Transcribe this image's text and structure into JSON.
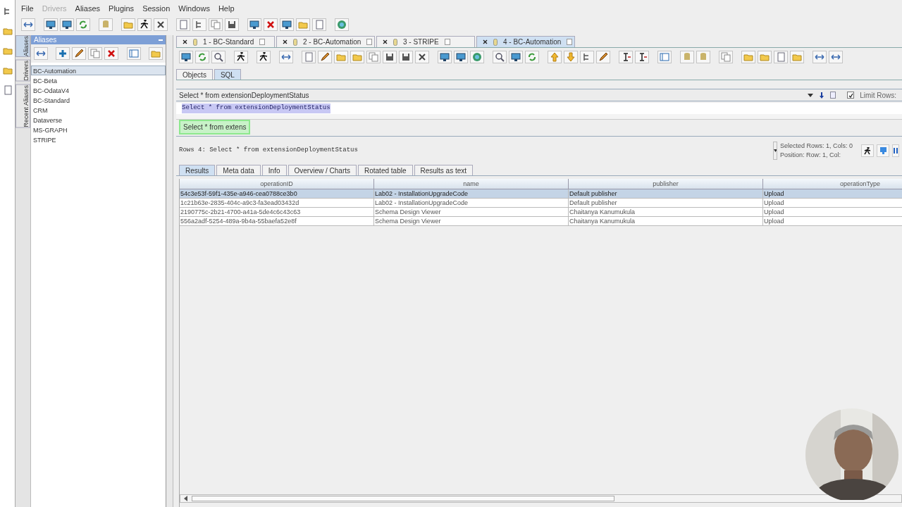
{
  "menu": [
    {
      "label": "File",
      "disabled": false
    },
    {
      "label": "Drivers",
      "disabled": true
    },
    {
      "label": "Aliases",
      "disabled": false
    },
    {
      "label": "Plugins",
      "disabled": false
    },
    {
      "label": "Session",
      "disabled": false
    },
    {
      "label": "Windows",
      "disabled": false
    },
    {
      "label": "Help",
      "disabled": false
    }
  ],
  "side_tabs": [
    {
      "label": "Aliases",
      "selected": true
    },
    {
      "label": "Drivers",
      "selected": false
    },
    {
      "label": "Recent Aliases",
      "selected": false
    }
  ],
  "aliases_panel": {
    "title": "Aliases",
    "items": [
      {
        "label": "BC-Automation",
        "selected": true
      },
      {
        "label": "BC-Beta",
        "selected": false
      },
      {
        "label": "BC-OdataV4",
        "selected": false
      },
      {
        "label": "BC-Standard",
        "selected": false
      },
      {
        "label": "CRM",
        "selected": false
      },
      {
        "label": "Dataverse",
        "selected": false
      },
      {
        "label": "MS-GRAPH",
        "selected": false
      },
      {
        "label": "STRIPE",
        "selected": false
      }
    ]
  },
  "session_tabs": [
    {
      "label": "1 - BC-Standard",
      "selected": false
    },
    {
      "label": "2 - BC-Automation",
      "selected": false
    },
    {
      "label": "3 - STRIPE",
      "selected": false
    },
    {
      "label": "4 - BC-Automation",
      "selected": true
    }
  ],
  "editor_tabs": [
    {
      "label": "Objects",
      "selected": false
    },
    {
      "label": "SQL",
      "selected": true
    }
  ],
  "sql_history": "Select * from extensionDeploymentStatus",
  "limit_rows": {
    "label": "Limit Rows:",
    "checked": true
  },
  "sql_text": "Select * from extensionDeploymentStatus",
  "result_tab": "Select * from extens",
  "rows_summary": "Rows 4:  Select * from extensionDeploymentStatus",
  "selection_info": [
    "Selected Rows: 1, Cols: 0",
    "Position: Row: 1, Col:"
  ],
  "result_tabs": [
    {
      "label": "Results",
      "selected": true
    },
    {
      "label": "Meta data",
      "selected": false
    },
    {
      "label": "Info",
      "selected": false
    },
    {
      "label": "Overview / Charts",
      "selected": false
    },
    {
      "label": "Rotated table",
      "selected": false
    },
    {
      "label": "Results as text",
      "selected": false
    }
  ],
  "table": {
    "columns": [
      "operationID",
      "name",
      "publisher",
      "operationType"
    ],
    "rows": [
      {
        "selected": true,
        "cells": [
          "54c3e53f-59f1-435e-a946-cea0788ce3b0",
          "Lab02 - InstallationUpgradeCode",
          "Default publisher",
          "Upload"
        ]
      },
      {
        "selected": false,
        "cells": [
          "1c21b63e-2835-404c-a9c3-fa3ead03432d",
          "Lab02 - InstallationUpgradeCode",
          "Default publisher",
          "Upload"
        ]
      },
      {
        "selected": false,
        "cells": [
          "2190775c-2b21-4700-a41a-5de4c6c43c63",
          "Schema Design Viewer",
          "Chaitanya Kanumukula",
          "Upload"
        ]
      },
      {
        "selected": false,
        "cells": [
          "556a2adf-5254-489a-9b4a-55baefa52e8f",
          "Schema Design Viewer",
          "Chaitanya Kanumukula",
          "Upload"
        ]
      }
    ]
  },
  "webcam": {
    "kind": "picture"
  }
}
